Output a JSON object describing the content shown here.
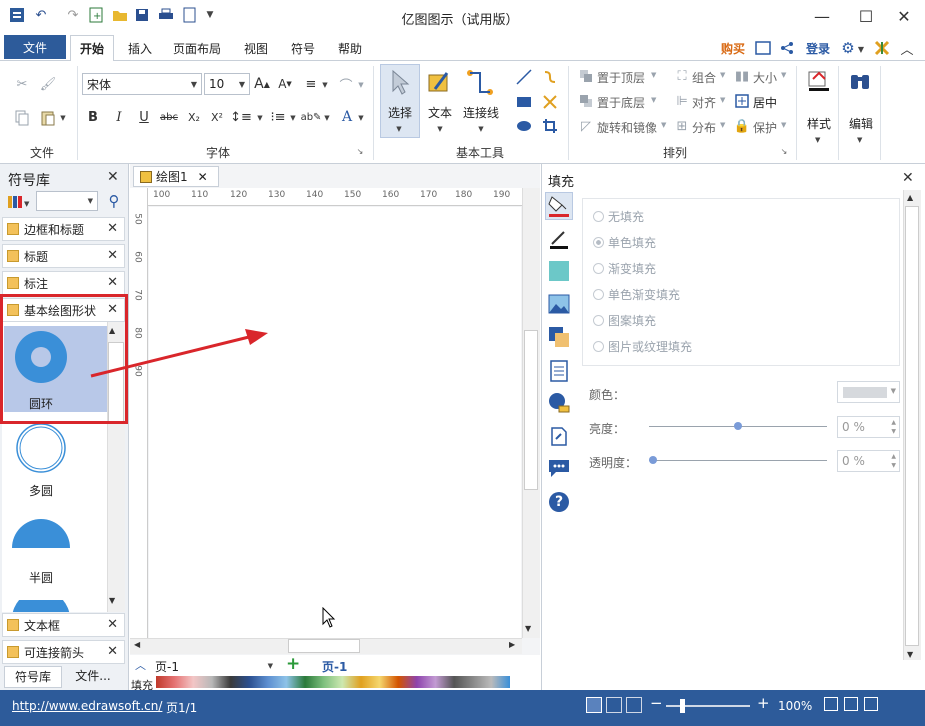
{
  "window": {
    "title": "亿图图示（试用版）",
    "minimize": "—",
    "maximize": "☐",
    "close": "✕"
  },
  "menu": {
    "file": "文件",
    "tabs": [
      "开始",
      "插入",
      "页面布局",
      "视图",
      "符号",
      "帮助"
    ],
    "buy": "购买",
    "login": "登录"
  },
  "ribbon": {
    "groups": {
      "file": "文件",
      "font": "字体",
      "basic_tools": "基本工具",
      "arrange": "排列"
    },
    "font_name": "宋体",
    "font_size": "10",
    "tools": {
      "select": "选择",
      "text": "文本",
      "connector": "连接线"
    },
    "arrange": {
      "bring_front": "置于顶层",
      "send_back": "置于底层",
      "rotate_mirror": "旋转和镜像",
      "group": "组合",
      "align": "对齐",
      "distribute": "分布",
      "size": "大小",
      "center": "居中",
      "protect": "保护"
    },
    "style": "样式",
    "edit": "编辑"
  },
  "library": {
    "title": "符号库",
    "items": [
      "边框和标题",
      "标题",
      "标注",
      "基本绘图形状"
    ],
    "shapes": [
      "圆环",
      "多圆",
      "半圆"
    ],
    "bottom_items": [
      "文本框",
      "可连接箭头"
    ],
    "tabs": [
      "符号库",
      "文件..."
    ]
  },
  "canvas": {
    "doc_tab": "绘图1",
    "ruler_h": [
      "100",
      "110",
      "120",
      "130",
      "140",
      "150",
      "160",
      "170",
      "180",
      "190"
    ],
    "ruler_v": [
      "50",
      "60",
      "70",
      "80",
      "90"
    ]
  },
  "pages": {
    "page_select": "页-1",
    "add": "+",
    "page_tab": "页-1",
    "fill_label": "填充"
  },
  "fill_panel": {
    "title": "填充",
    "options": [
      "无填充",
      "单色填充",
      "渐变填充",
      "单色渐变填充",
      "图案填充",
      "图片或纹理填充"
    ],
    "color_label": "颜色：",
    "brightness_label": "亮度：",
    "brightness_value": "0 %",
    "transparency_label": "透明度：",
    "transparency_value": "0 %"
  },
  "status": {
    "url": "http://www.edrawsoft.cn/",
    "page": "页1/1",
    "zoom": "100%",
    "minus": "−",
    "plus": "+"
  },
  "colors": {
    "accent": "#2d5b9a",
    "shape_blue": "#3a8fd8",
    "highlight_red": "#d9262b",
    "selected_bg": "#b8c8e8"
  }
}
